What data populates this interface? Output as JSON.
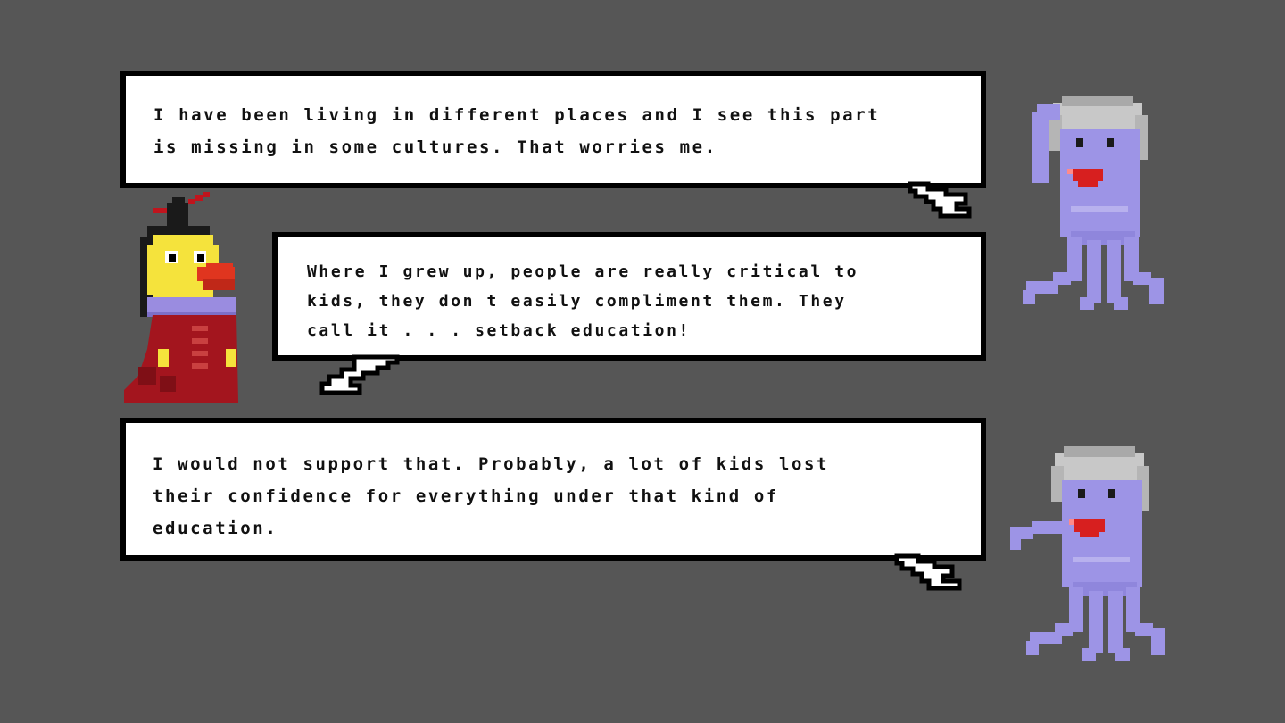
{
  "dialogue": [
    {
      "speaker": "purple-octopus",
      "text": "I have been living in different places and I see this part\nis missing in some cultures. That worries me."
    },
    {
      "speaker": "yellow-bird",
      "text": "Where I grew up, people are really critical to\nkids, they don t easily compliment them. They\ncall it . . . setback education!"
    },
    {
      "speaker": "purple-octopus",
      "text": "I would not support that. Probably, a lot of kids lost\ntheir confidence for everything under that kind of\neducation."
    }
  ],
  "colors": {
    "background": "#565656",
    "bubble_fill": "#ffffff",
    "bubble_border": "#000000",
    "octopus_body": "#9d94e6",
    "octopus_hair": "#c8c8c8",
    "octopus_mouth": "#d71f1f",
    "bird_head": "#f5e33c",
    "bird_beak": "#e0351f",
    "bird_robe": "#a3151e",
    "bird_collar": "#9a8ce0"
  },
  "characters": {
    "octopus_icon": "purple-octopus-character",
    "bird_icon": "yellow-bird-character"
  }
}
